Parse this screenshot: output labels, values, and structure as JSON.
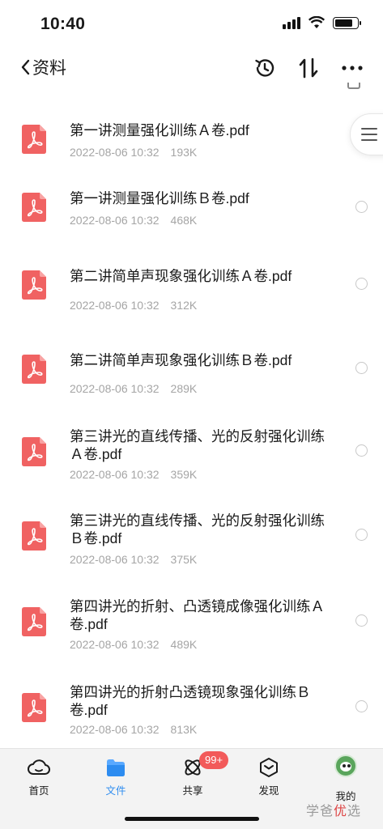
{
  "status": {
    "time": "10:40"
  },
  "header": {
    "back_label": "资料",
    "history_icon": "history-icon",
    "sort_icon": "sort-icon",
    "more_icon": "more-icon"
  },
  "files": [
    {
      "name": "第一讲测量强化训练Ａ卷.pdf",
      "date": "2022-08-06 10:32",
      "size": "193K"
    },
    {
      "name": "第一讲测量强化训练Ｂ卷.pdf",
      "date": "2022-08-06 10:32",
      "size": "468K"
    },
    {
      "name": "第二讲简单声现象强化训练Ａ卷.pdf",
      "date": "2022-08-06 10:32",
      "size": "312K"
    },
    {
      "name": "第二讲简单声现象强化训练Ｂ卷.pdf",
      "date": "2022-08-06 10:32",
      "size": "289K"
    },
    {
      "name": "第三讲光的直线传播、光的反射强化训练Ａ卷.pdf",
      "date": "2022-08-06 10:32",
      "size": "359K"
    },
    {
      "name": "第三讲光的直线传播、光的反射强化训练Ｂ卷.pdf",
      "date": "2022-08-06 10:32",
      "size": "375K"
    },
    {
      "name": "第四讲光的折射、凸透镜成像强化训练Ａ卷.pdf",
      "date": "2022-08-06 10:32",
      "size": "489K"
    },
    {
      "name": "第四讲光的折射凸透镜现象强化训练Ｂ卷.pdf",
      "date": "2022-08-06 10:32",
      "size": "813K"
    }
  ],
  "tabbar": {
    "tabs": [
      {
        "label": "首页",
        "icon": "cloud-icon"
      },
      {
        "label": "文件",
        "icon": "folder-icon"
      },
      {
        "label": "共享",
        "icon": "share-icon"
      },
      {
        "label": "发现",
        "icon": "discover-icon"
      },
      {
        "label": "我的",
        "icon": "avatar-icon"
      }
    ],
    "share_badge": "99+"
  },
  "watermark": {
    "left": "学爸",
    "mid": "优",
    "right": "选"
  },
  "colors": {
    "pdf_red": "#f06262",
    "active_blue": "#2d8cf0",
    "badge_red": "#f25a5a"
  }
}
